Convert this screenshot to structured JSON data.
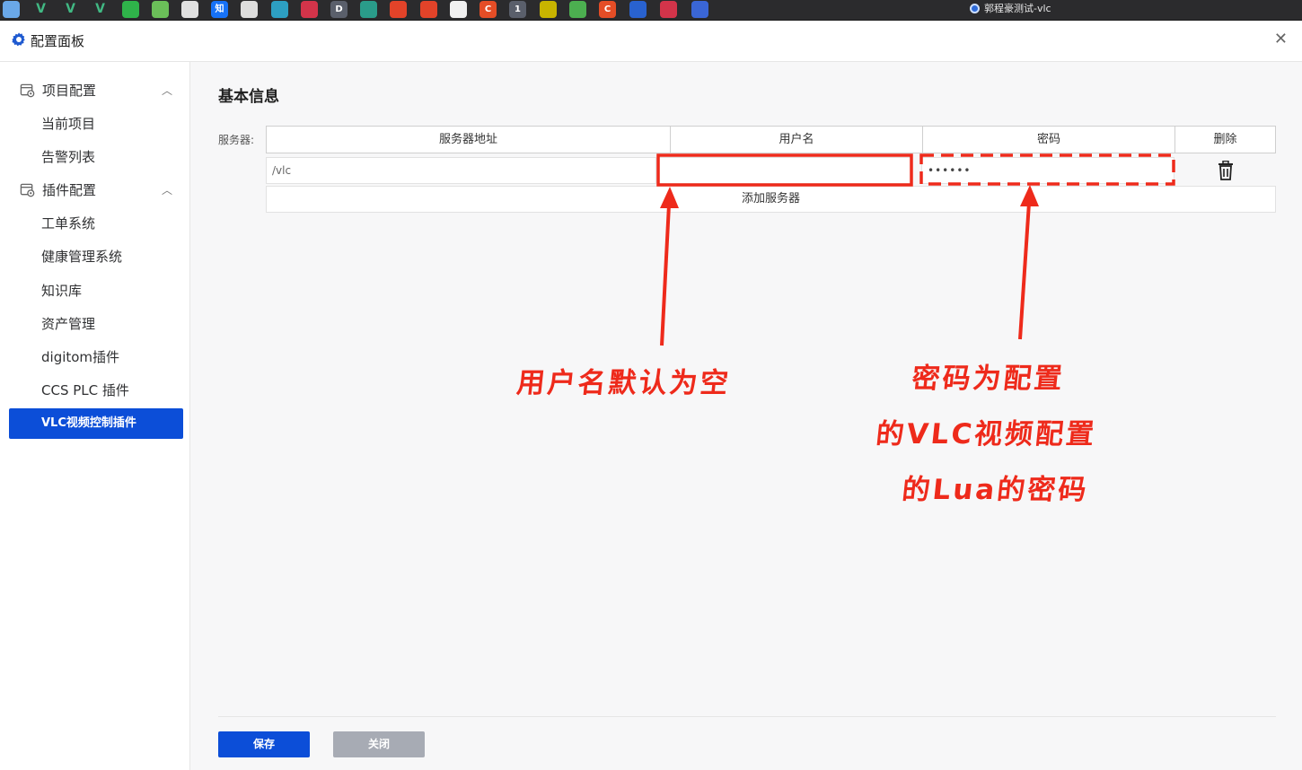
{
  "browser": {
    "active_tab_title": "郭程豪测试-vlc",
    "tab_icons": [
      {
        "name": "browser-icon",
        "color": "#6aa8e8",
        "glyph": ""
      },
      {
        "name": "vue-icon",
        "color": "#2b2b2d",
        "glyph": "V"
      },
      {
        "name": "vue-icon",
        "color": "#2b2b2d",
        "glyph": "V"
      },
      {
        "name": "vue-icon",
        "color": "#2b2b2d",
        "glyph": "V"
      },
      {
        "name": "green-circle-icon",
        "color": "#2fb34a",
        "glyph": ""
      },
      {
        "name": "green-app-icon",
        "color": "#6bbf59",
        "glyph": ""
      },
      {
        "name": "document-icon",
        "color": "#e0e0e0",
        "glyph": ""
      },
      {
        "name": "zhihu-icon",
        "color": "#1772f6",
        "glyph": "知"
      },
      {
        "name": "book-icon",
        "color": "#dddddd",
        "glyph": ""
      },
      {
        "name": "teal-circle-icon",
        "color": "#2d9fc2",
        "glyph": ""
      },
      {
        "name": "red-circle-icon",
        "color": "#d3344a",
        "glyph": ""
      },
      {
        "name": "d-icon",
        "color": "#5a5f6b",
        "glyph": "D"
      },
      {
        "name": "play-icon",
        "color": "#2a9c8a",
        "glyph": ""
      },
      {
        "name": "gitlab-icon",
        "color": "#e24329",
        "glyph": ""
      },
      {
        "name": "gitlab-icon",
        "color": "#e24329",
        "glyph": ""
      },
      {
        "name": "github-icon",
        "color": "#f0f0f0",
        "glyph": ""
      },
      {
        "name": "c-red-icon",
        "color": "#e44d26",
        "glyph": "C"
      },
      {
        "name": "number-one-icon",
        "color": "#5a5f6b",
        "glyph": "1"
      },
      {
        "name": "yellow-app-icon",
        "color": "#c8b400",
        "glyph": ""
      },
      {
        "name": "green-ball-icon",
        "color": "#4caf50",
        "glyph": ""
      },
      {
        "name": "c-red-icon",
        "color": "#e44d26",
        "glyph": "C"
      },
      {
        "name": "blue-hex-icon",
        "color": "#2962cf",
        "glyph": ""
      },
      {
        "name": "red-circle-icon",
        "color": "#d3344a",
        "glyph": ""
      },
      {
        "name": "blue-circle-icon",
        "color": "#3a66d6",
        "glyph": ""
      }
    ]
  },
  "header": {
    "title": "配置面板"
  },
  "sidebar": {
    "groups": [
      {
        "label": "项目配置",
        "items": [
          "当前项目",
          "告警列表"
        ]
      },
      {
        "label": "插件配置",
        "items": [
          "工单系统",
          "健康管理系统",
          "知识库",
          "资产管理",
          "digitom插件",
          "CCS PLC 插件",
          "VLC视频控制插件"
        ]
      }
    ],
    "active_item": "VLC视频控制插件"
  },
  "main": {
    "section_title": "基本信息",
    "servers_label": "服务器:",
    "columns": [
      "服务器地址",
      "用户名",
      "密码",
      "删除"
    ],
    "rows": [
      {
        "address": "/vlc",
        "username": "",
        "password": "••••••"
      }
    ],
    "add_server_label": "添加服务器",
    "save_label": "保存",
    "close_label": "关闭"
  },
  "annotations": {
    "color": "#ee2a1b",
    "username_note": "用户名默认为空",
    "password_note_lines": [
      "密码为配置",
      "的VLC视频配置",
      "的Lua的密码"
    ]
  }
}
